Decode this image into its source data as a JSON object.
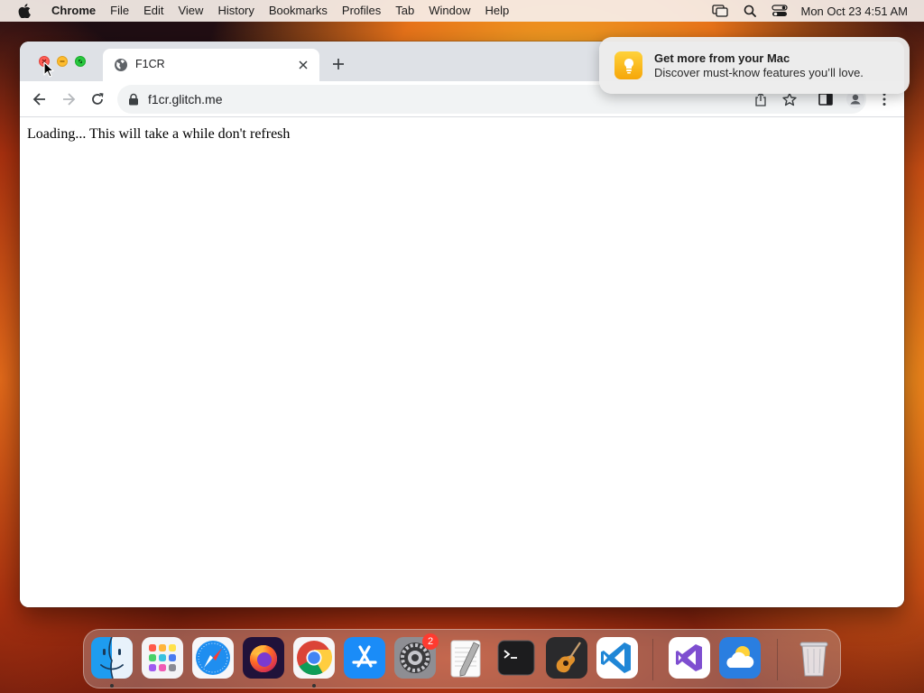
{
  "menubar": {
    "app_name": "Chrome",
    "items": [
      "File",
      "Edit",
      "View",
      "History",
      "Bookmarks",
      "Profiles",
      "Tab",
      "Window",
      "Help"
    ],
    "clock": "Mon Oct 23  4:51 AM"
  },
  "browser": {
    "tab_title": "F1CR",
    "url": "f1cr.glitch.me"
  },
  "page": {
    "text": "Loading... This will take a while don't refresh"
  },
  "notification": {
    "title": "Get more from your Mac",
    "body": "Discover must-know features you’ll love."
  },
  "dock": {
    "apps": [
      "Finder",
      "Launchpad",
      "Safari",
      "Firefox",
      "Google Chrome",
      "App Store",
      "System Settings",
      "TextEdit",
      "Terminal",
      "GarageBand",
      "Visual Studio Code",
      "Visual Studio",
      "Weather",
      "Trash"
    ],
    "system_settings_badge": "2"
  },
  "colors": {
    "close": "#ff5f57",
    "minimize": "#febc2e",
    "maximize": "#28c840",
    "tab_strip": "#dee1e6",
    "omnibox": "#f1f3f4",
    "badge": "#ff3b30"
  }
}
